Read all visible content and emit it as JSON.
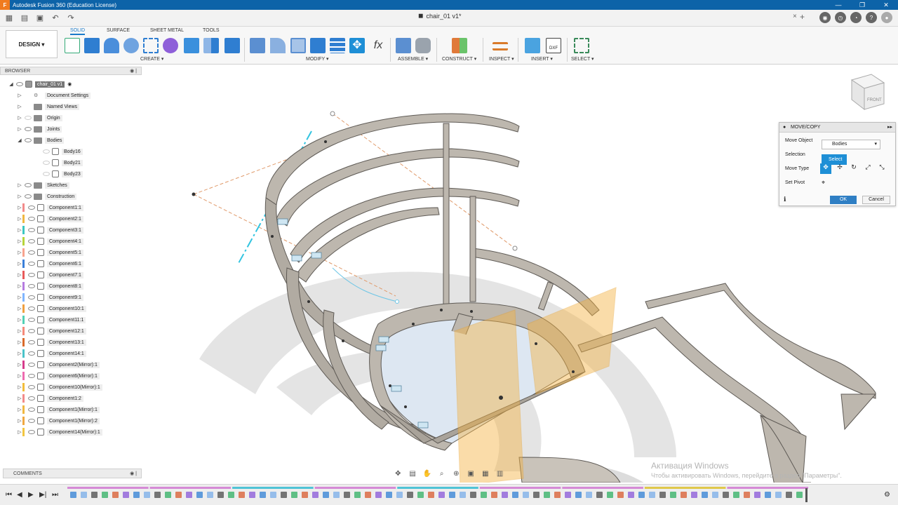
{
  "window": {
    "title": "Autodesk Fusion 360 (Education License)",
    "controls": [
      "—",
      "❐",
      "✕"
    ]
  },
  "document_tab": {
    "name": "chair_01 v1*",
    "close": "×"
  },
  "workspace": {
    "label": "DESIGN ▾"
  },
  "ribbon_tabs": [
    "SOLID",
    "SURFACE",
    "SHEET METAL",
    "TOOLS"
  ],
  "ribbon_groups": [
    "CREATE ▾",
    "MODIFY ▾",
    "ASSEMBLE ▾",
    "CONSTRUCT ▾",
    "INSPECT ▾",
    "INSERT ▾",
    "SELECT ▾"
  ],
  "browser": {
    "title": "BROWSER",
    "root": "chair_01 v1",
    "items": [
      {
        "label": "Document Settings",
        "kind": "gear"
      },
      {
        "label": "Named Views",
        "kind": "folder"
      },
      {
        "label": "Origin",
        "kind": "folder"
      },
      {
        "label": "Joints",
        "kind": "folder"
      },
      {
        "label": "Bodies",
        "kind": "folder"
      },
      {
        "label": "Body16",
        "kind": "body"
      },
      {
        "label": "Body21",
        "kind": "body"
      },
      {
        "label": "Body23",
        "kind": "body"
      },
      {
        "label": "Sketches",
        "kind": "folder"
      },
      {
        "label": "Construction",
        "kind": "folder"
      }
    ],
    "components": [
      {
        "label": "Component1:1",
        "color": "#f28b8b"
      },
      {
        "label": "Component2:1",
        "color": "#f0b842"
      },
      {
        "label": "Component3:1",
        "color": "#3cc7c2"
      },
      {
        "label": "Component4:1",
        "color": "#b7d43a"
      },
      {
        "label": "Component5:1",
        "color": "#f7a38e"
      },
      {
        "label": "Component6:1",
        "color": "#3b7fd9"
      },
      {
        "label": "Component7:1",
        "color": "#e85a5a"
      },
      {
        "label": "Component8:1",
        "color": "#b57be0"
      },
      {
        "label": "Component9:1",
        "color": "#7fb5ff"
      },
      {
        "label": "Component10:1",
        "color": "#f0a040"
      },
      {
        "label": "Component11:1",
        "color": "#53d1b5"
      },
      {
        "label": "Component12:1",
        "color": "#f58a7a"
      },
      {
        "label": "Component13:1",
        "color": "#d96a2a"
      },
      {
        "label": "Component14:1",
        "color": "#4ac3c9"
      },
      {
        "label": "Component2(Mirror):1",
        "color": "#d63c8c"
      },
      {
        "label": "Component6(Mirror):1",
        "color": "#ee6bb0"
      },
      {
        "label": "Component10(Mirror):1",
        "color": "#f2bd3a"
      },
      {
        "label": "Component1:2",
        "color": "#f28b8b"
      },
      {
        "label": "Component1(Mirror):1",
        "color": "#f0b842"
      },
      {
        "label": "Component1(Mirror):2",
        "color": "#f0a842"
      },
      {
        "label": "Component14(Mirror):1",
        "color": "#f2c640"
      }
    ]
  },
  "comments": {
    "title": "COMMENTS"
  },
  "move_dialog": {
    "title": "MOVE/COPY",
    "move_object_label": "Move Object",
    "move_object_value": "Bodies",
    "selection_label": "Selection",
    "selection_value": "Select",
    "move_type_label": "Move Type",
    "set_pivot_label": "Set Pivot",
    "ok": "OK",
    "cancel": "Cancel"
  },
  "watermark": {
    "line1": "Активация Windows",
    "line2": "Чтобы активировать Windows, перейдите в раздел \"Параметры\"."
  },
  "colors": {
    "accent": "#1a7ac9",
    "titlebar": "#0d63a8",
    "plane": "#f5b342",
    "body": "#bdb7ae"
  }
}
